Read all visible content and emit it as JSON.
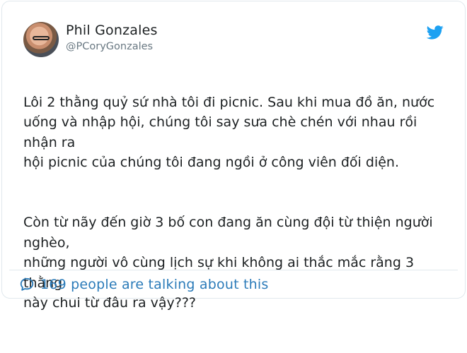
{
  "author": {
    "name": "Phil Gonzales",
    "handle": "@PCoryGonzales"
  },
  "tweet": {
    "paragraphs": [
      "Lôi 2 thằng quỷ sứ nhà tôi đi picnic. Sau khi mua đồ ăn, nước\nuống và nhập hội, chúng tôi say sưa chè chén với nhau rồi nhận ra\nhội picnic của chúng tôi đang ngồi ở công viên đối diện.",
      "Còn từ nãy đến giờ 3 bố con đang ăn cùng đội từ thiện người nghèo,\nnhững người vô cùng lịch sự khi không ai thắc mắc rằng 3 thằng\nnày chui từ đâu ra vậy???"
    ]
  },
  "footer": {
    "talking_text": "169 people are talking about this"
  },
  "icons": {
    "brand": "twitter-bird-icon",
    "conversation": "speech-bubble-icon"
  },
  "colors": {
    "twitter_blue": "#1da1f2",
    "link_blue": "#2b7bb9",
    "border": "#e1e8ed",
    "muted": "#697882"
  }
}
